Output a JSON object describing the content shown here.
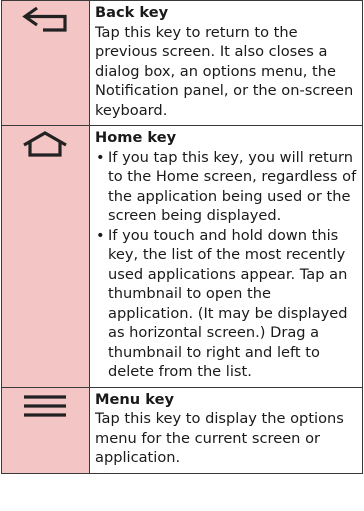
{
  "keys": [
    {
      "icon": "back-arrow-icon",
      "title": "Back key",
      "description": "Tap this key to return to the previous screen. It also closes a dialog box, an options menu, the Notification panel, or the on-screen keyboard."
    },
    {
      "icon": "home-icon",
      "title": "Home key",
      "bullets": [
        "If you tap this key, you will return to the Home screen, regardless of the application being used or the screen being displayed.",
        "If you touch and hold down this key, the list of the most recently used applications appear. Tap an thumbnail to open the application. (It may be displayed as horizontal screen.) Drag a thumbnail to right and left to delete from the list."
      ]
    },
    {
      "icon": "menu-icon",
      "title": "Menu key",
      "description": "Tap this key to display the options menu for the current screen or application."
    }
  ],
  "colors": {
    "icon_cell_bg": "#f3c6c5",
    "border": "#3a3a3a",
    "icon_stroke": "#222222"
  }
}
